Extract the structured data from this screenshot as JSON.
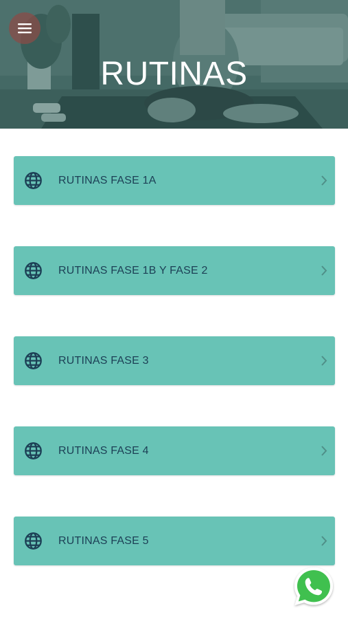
{
  "header": {
    "title": "RUTINAS",
    "menu_icon": "hamburger-menu-icon"
  },
  "items": [
    {
      "label": "RUTINAS FASE 1A",
      "icon": "globe-icon"
    },
    {
      "label": "RUTINAS FASE 1B Y FASE 2",
      "icon": "globe-icon"
    },
    {
      "label": "RUTINAS FASE 3",
      "icon": "globe-icon"
    },
    {
      "label": "RUTINAS FASE 4",
      "icon": "globe-icon"
    },
    {
      "label": "RUTINAS FASE 5",
      "icon": "globe-icon"
    }
  ],
  "floating_button": {
    "icon": "whatsapp-icon"
  },
  "colors": {
    "item_background": "#68c3b6",
    "item_text": "#1c3f55",
    "hero_overlay": "#3e6663",
    "whatsapp_green": "#3fc04f"
  }
}
